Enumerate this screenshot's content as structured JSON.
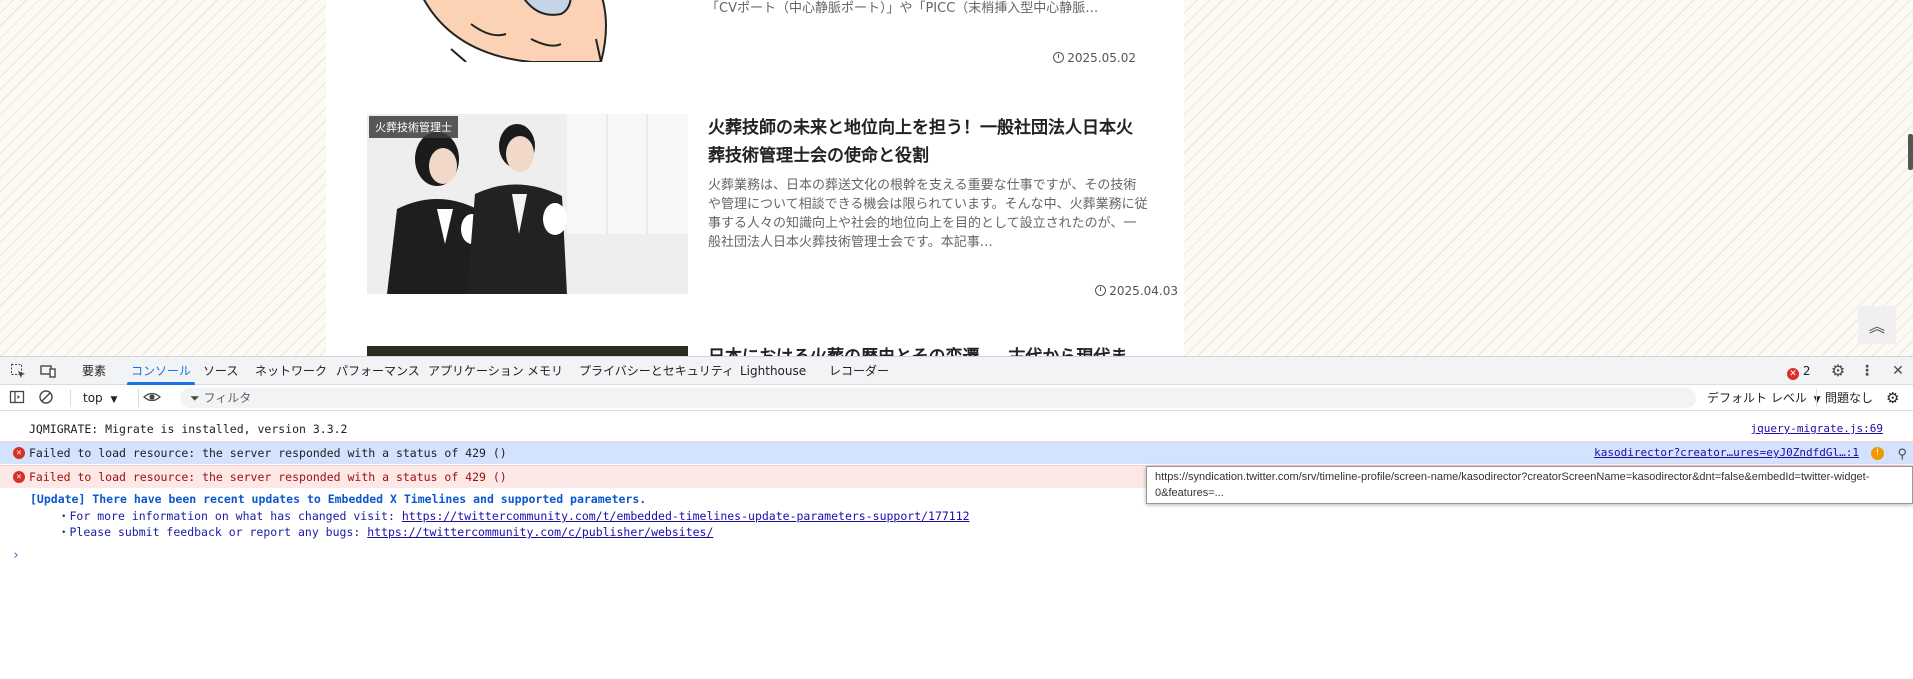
{
  "page": {
    "articles": [
      {
        "excerpt_tail": "「CVポート（中心静脈ポート）」や「PICC（末梢挿入型中心静脈…",
        "date": "2025.05.02"
      },
      {
        "category": "火葬技術管理士",
        "title": "火葬技師の未来と地位向上を担う！一般社団法人日本火葬技術管理士会の使命と役割",
        "excerpt": "火葬業務は、日本の葬送文化の根幹を支える重要な仕事ですが、その技術や管理について相談できる機会は限られています。そんな中、火葬業務に従事する人々の知識向上や社会的地位向上を目的として設立されたのが、一般社団法人日本火葬技術管理士会です。本記事…",
        "date": "2025.04.03"
      },
      {
        "title_partial": "日本における火葬の歴史とその変遷 ― 古代から現代ま"
      }
    ]
  },
  "devtools": {
    "tabs": [
      "要素",
      "コンソール",
      "ソース",
      "ネットワーク",
      "パフォーマンス",
      "アプリケーション",
      "メモリ",
      "プライバシーとセキュリティ",
      "Lighthouse",
      "レコーダー"
    ],
    "active_tab": "コンソール",
    "error_count": "2",
    "toolbar": {
      "context": "top",
      "filter_placeholder": "フィルタ",
      "level": "デフォルト レベル",
      "issues": "問題なし"
    },
    "messages": [
      {
        "text": "JQMIGRATE: Migrate is installed, version 3.3.2",
        "source": "jquery-migrate.js:69"
      },
      {
        "text": "Failed to load resource: the server responded with a status of 429 ()",
        "source": "kasodirector?creator…ures=eyJ0ZndfdGl…:1"
      },
      {
        "text": "Failed to load resource: the server responded with a status of 429 ()"
      }
    ],
    "x_update": {
      "headline": "[Update] There have been recent updates to Embedded X Timelines and supported parameters.",
      "line1_prefix": "・For more information on what has changed visit: ",
      "line1_link": "https://twittercommunity.com/t/embedded-timelines-update-parameters-support/177112",
      "line2_prefix": "・Please submit feedback or report any bugs: ",
      "line2_link": "https://twittercommunity.com/c/publisher/websites/"
    },
    "tooltip": "https://syndication.twitter.com/srv/timeline-profile/screen-name/kasodirector?creatorScreenName=kasodirector&dnt=false&embedId=twitter-widget-0&features=...",
    "prompt": "›"
  }
}
